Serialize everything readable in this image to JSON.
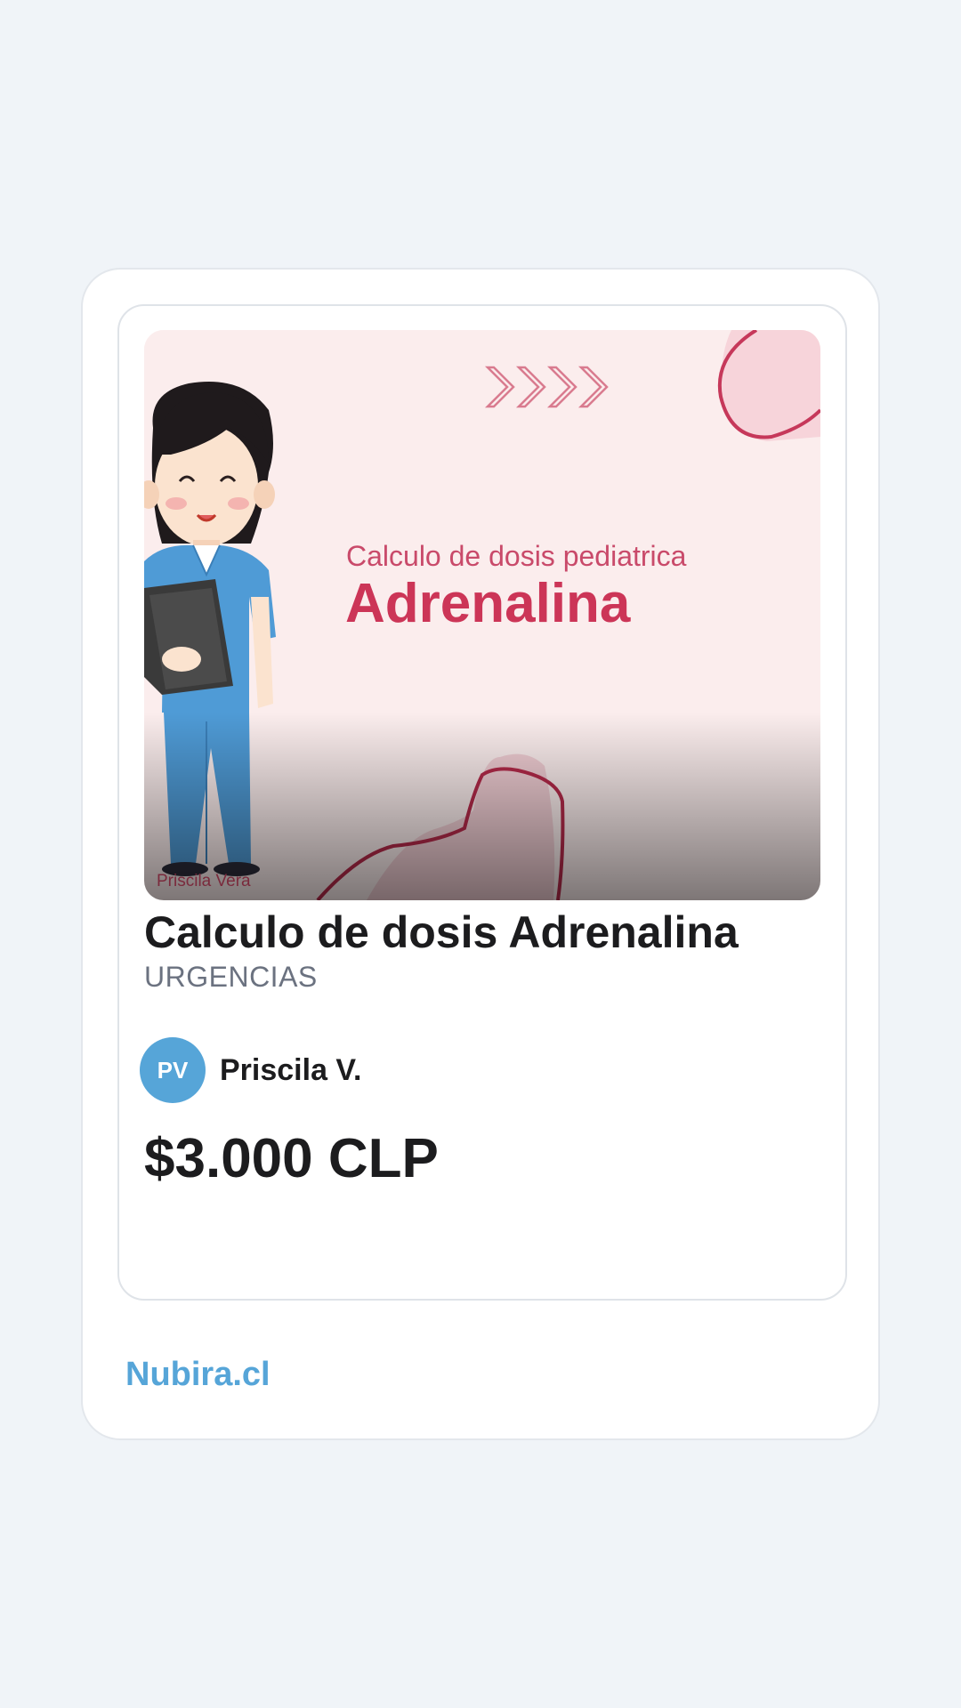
{
  "product": {
    "cover": {
      "subtitle": "Calculo de dosis pediatrica",
      "title": "Adrenalina",
      "author": "Priscila Vera",
      "illustration": "nurse-illustration"
    },
    "title": "Calculo de dosis Adrenalina",
    "category": "URGENCIAS",
    "seller": {
      "initials": "PV",
      "name": "Priscila V."
    },
    "price": "$3.000 CLP"
  },
  "footer": {
    "brand": "Nubira.cl"
  },
  "colors": {
    "background": "#f0f4f8",
    "accent": "#56a5d8",
    "cover_accent": "#cc3557",
    "text": "#1c1c1e",
    "muted": "#6b7280"
  }
}
